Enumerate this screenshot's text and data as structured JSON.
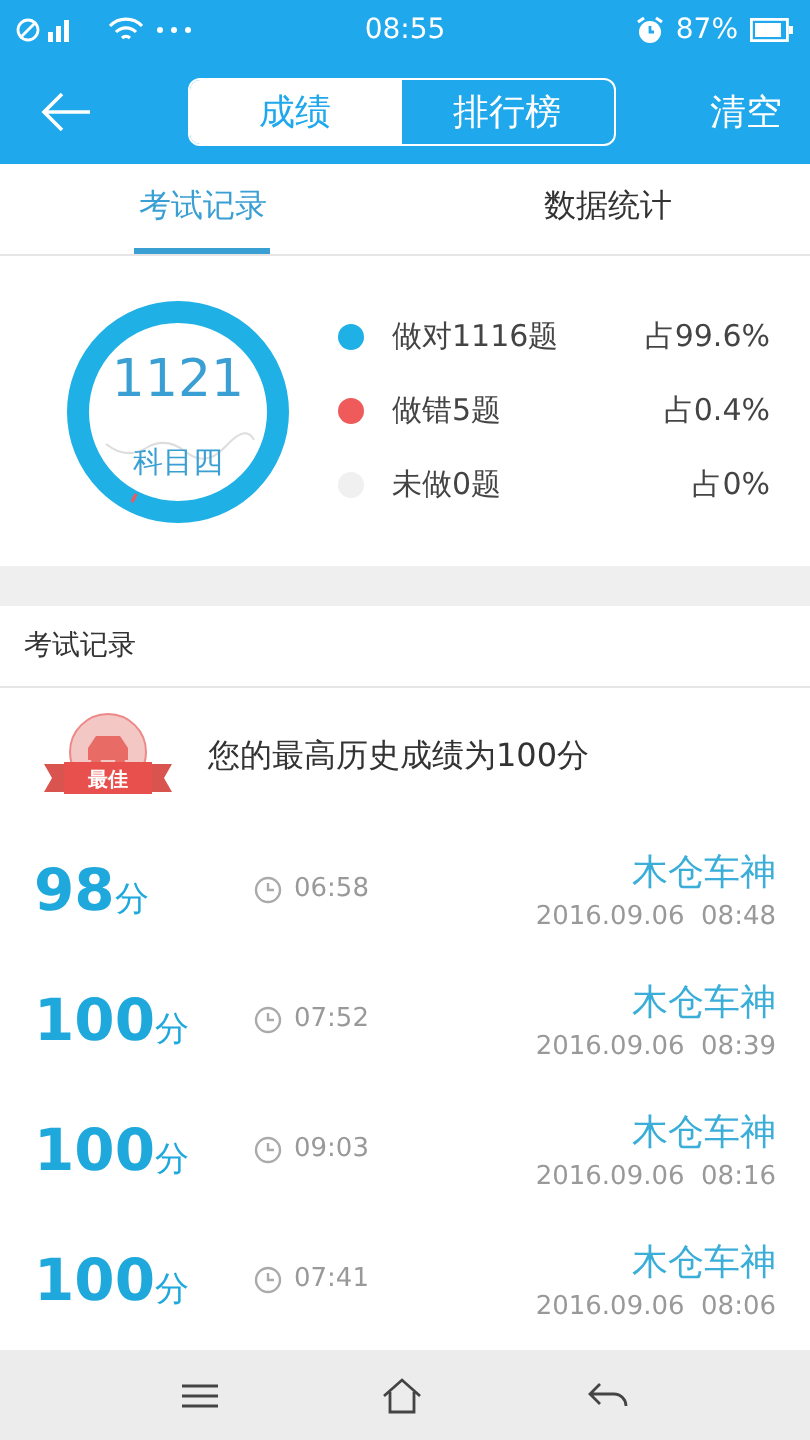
{
  "status_bar": {
    "time": "08:55",
    "battery": "87%"
  },
  "nav": {
    "segments": [
      {
        "label": "成绩",
        "selected": true
      },
      {
        "label": "排行榜",
        "selected": false
      }
    ],
    "action": "清空"
  },
  "tabs": [
    {
      "label": "考试记录",
      "selected": true
    },
    {
      "label": "数据统计",
      "selected": false
    }
  ],
  "summary": {
    "total": "1121",
    "subject": "科目四",
    "legend": [
      {
        "label": "做对1116题",
        "share": "占99.6%",
        "color": "#1fb0e6"
      },
      {
        "label": "做错5题",
        "share": "占0.4%",
        "color": "#ef5a5a"
      },
      {
        "label": "未做0题",
        "share": "占0%",
        "color": "#f0f0f0"
      }
    ]
  },
  "section_title": "考试记录",
  "best": {
    "badge": "最佳",
    "text": "您的最高历史成绩为100分"
  },
  "records": [
    {
      "score": "98",
      "unit": "分",
      "duration": "06:58",
      "title": "木仓车神",
      "date": "2016.09.06  08:48"
    },
    {
      "score": "100",
      "unit": "分",
      "duration": "07:52",
      "title": "木仓车神",
      "date": "2016.09.06  08:39"
    },
    {
      "score": "100",
      "unit": "分",
      "duration": "09:03",
      "title": "木仓车神",
      "date": "2016.09.06  08:16"
    },
    {
      "score": "100",
      "unit": "分",
      "duration": "07:41",
      "title": "木仓车神",
      "date": "2016.09.06  08:06"
    }
  ]
}
